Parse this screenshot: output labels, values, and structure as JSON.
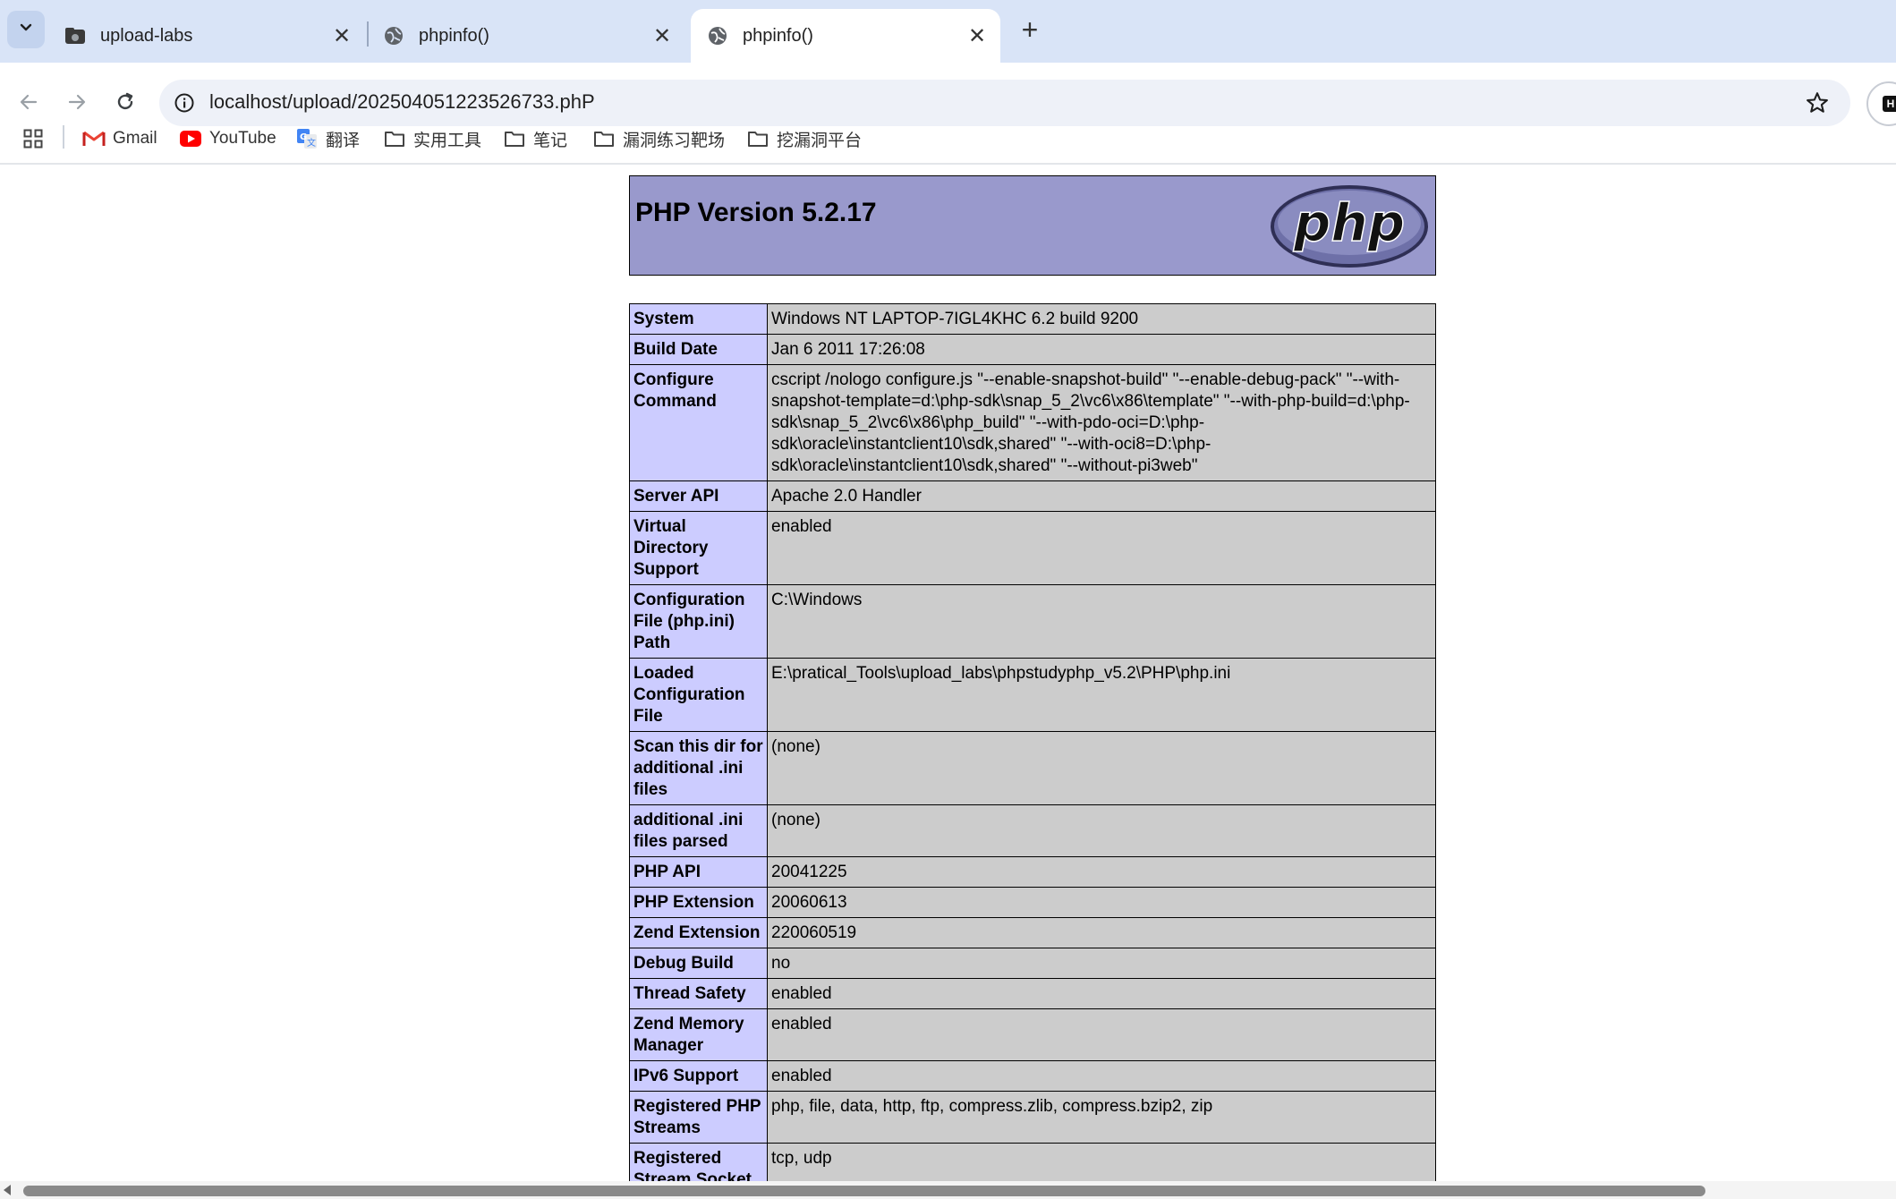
{
  "tabs": [
    {
      "title": "upload-labs",
      "icon": "folder-tab-icon",
      "active": false
    },
    {
      "title": "phpinfo()",
      "icon": "globe-icon",
      "active": false
    },
    {
      "title": "phpinfo()",
      "icon": "globe-icon",
      "active": true
    }
  ],
  "toolbar": {
    "url": "localhost/upload/202504051223526733.phP"
  },
  "bookmarks": [
    {
      "label": "",
      "icon": "apps-grid-icon"
    },
    {
      "label": "Gmail",
      "icon": "gmail-icon"
    },
    {
      "label": "YouTube",
      "icon": "youtube-icon"
    },
    {
      "label": "翻译",
      "icon": "translate-icon"
    },
    {
      "label": "实用工具",
      "icon": "folder-icon"
    },
    {
      "label": "笔记",
      "icon": "folder-icon"
    },
    {
      "label": "漏洞练习靶场",
      "icon": "folder-icon"
    },
    {
      "label": "挖漏洞平台",
      "icon": "folder-icon"
    }
  ],
  "phpinfo": {
    "title": "PHP Version 5.2.17",
    "logo_text": "php",
    "rows": [
      {
        "key": "System",
        "value": "Windows NT LAPTOP-7IGL4KHC 6.2 build 9200"
      },
      {
        "key": "Build Date",
        "value": "Jan 6 2011 17:26:08"
      },
      {
        "key": "Configure Command",
        "value": "cscript /nologo configure.js \"--enable-snapshot-build\" \"--enable-debug-pack\" \"--with-snapshot-template=d:\\php-sdk\\snap_5_2\\vc6\\x86\\template\" \"--with-php-build=d:\\php-sdk\\snap_5_2\\vc6\\x86\\php_build\" \"--with-pdo-oci=D:\\php-sdk\\oracle\\instantclient10\\sdk,shared\" \"--with-oci8=D:\\php-sdk\\oracle\\instantclient10\\sdk,shared\" \"--without-pi3web\""
      },
      {
        "key": "Server API",
        "value": "Apache 2.0 Handler"
      },
      {
        "key": "Virtual Directory Support",
        "value": "enabled"
      },
      {
        "key": "Configuration File (php.ini) Path",
        "value": "C:\\Windows"
      },
      {
        "key": "Loaded Configuration File",
        "value": "E:\\pratical_Tools\\upload_labs\\phpstudyphp_v5.2\\PHP\\php.ini"
      },
      {
        "key": "Scan this dir for additional .ini files",
        "value": "(none)"
      },
      {
        "key": "additional .ini files parsed",
        "value": "(none)"
      },
      {
        "key": "PHP API",
        "value": "20041225"
      },
      {
        "key": "PHP Extension",
        "value": "20060613"
      },
      {
        "key": "Zend Extension",
        "value": "220060519"
      },
      {
        "key": "Debug Build",
        "value": "no"
      },
      {
        "key": "Thread Safety",
        "value": "enabled"
      },
      {
        "key": "Zend Memory Manager",
        "value": "enabled"
      },
      {
        "key": "IPv6 Support",
        "value": "enabled"
      },
      {
        "key": "Registered PHP Streams",
        "value": "php, file, data, http, ftp, compress.zlib, compress.bzip2, zip"
      },
      {
        "key": "Registered Stream Socket Transports",
        "value": "tcp, udp"
      }
    ]
  },
  "colors": {
    "tabstrip_bg": "#d9e4f7",
    "php_header_bg": "#9999cc",
    "key_cell_bg": "#ccccff",
    "value_cell_bg": "#cccccc"
  }
}
